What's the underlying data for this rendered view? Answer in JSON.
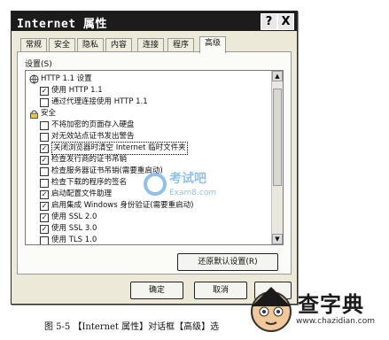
{
  "window": {
    "title": "Internet 属性"
  },
  "titlebar_buttons": {
    "help": "?",
    "close": "X"
  },
  "tabs": [
    {
      "label": "常规"
    },
    {
      "label": "安全"
    },
    {
      "label": "隐私"
    },
    {
      "label": "内容"
    },
    {
      "label": "连接"
    },
    {
      "label": "程序"
    },
    {
      "label": "高级"
    }
  ],
  "active_tab": "高级",
  "settings_label": "设置(S)",
  "settings": [
    {
      "type": "group",
      "label": "HTTP 1.1 设置"
    },
    {
      "type": "check",
      "label": "使用 HTTP 1.1",
      "checked": true
    },
    {
      "type": "check",
      "label": "通过代理连接使用 HTTP 1.1",
      "checked": false
    },
    {
      "type": "group",
      "label": "安全"
    },
    {
      "type": "check",
      "label": "不将加密的页面存入硬盘",
      "checked": false
    },
    {
      "type": "check",
      "label": "对无效站点证书发出警告",
      "checked": false
    },
    {
      "type": "check",
      "label": "关闭浏览器时清空 Internet 临时文件夹",
      "checked": true,
      "selected": true
    },
    {
      "type": "check",
      "label": "检查发行商的证书吊销",
      "checked": true
    },
    {
      "type": "check",
      "label": "检查服务器证书吊销(需要重启动)",
      "checked": false
    },
    {
      "type": "check",
      "label": "检查下载的程序的签名",
      "checked": false
    },
    {
      "type": "check",
      "label": "启动配置文件助理",
      "checked": true
    },
    {
      "type": "check",
      "label": "启用集成 Windows 身份验证(需要重启动)",
      "checked": true
    },
    {
      "type": "check",
      "label": "使用 SSL 2.0",
      "checked": true
    },
    {
      "type": "check",
      "label": "使用 SSL 3.0",
      "checked": true
    },
    {
      "type": "check",
      "label": "使用 TLS 1.0",
      "checked": false
    }
  ],
  "buttons": {
    "restore_defaults": "还原默认设置(R)",
    "ok": "确定",
    "cancel": "取消"
  },
  "watermark": {
    "text": "考试吧",
    "url": "Exam8.com"
  },
  "caption": "图 5-5 【Internet 属性】对话框【高级】选",
  "logo": {
    "text": "查字典",
    "url": "www.chazidian.com"
  },
  "colors": {
    "titlebar": "#1c1c1c",
    "dialog_bg": "#ece9d8",
    "watermark": "#3a8fd6"
  }
}
